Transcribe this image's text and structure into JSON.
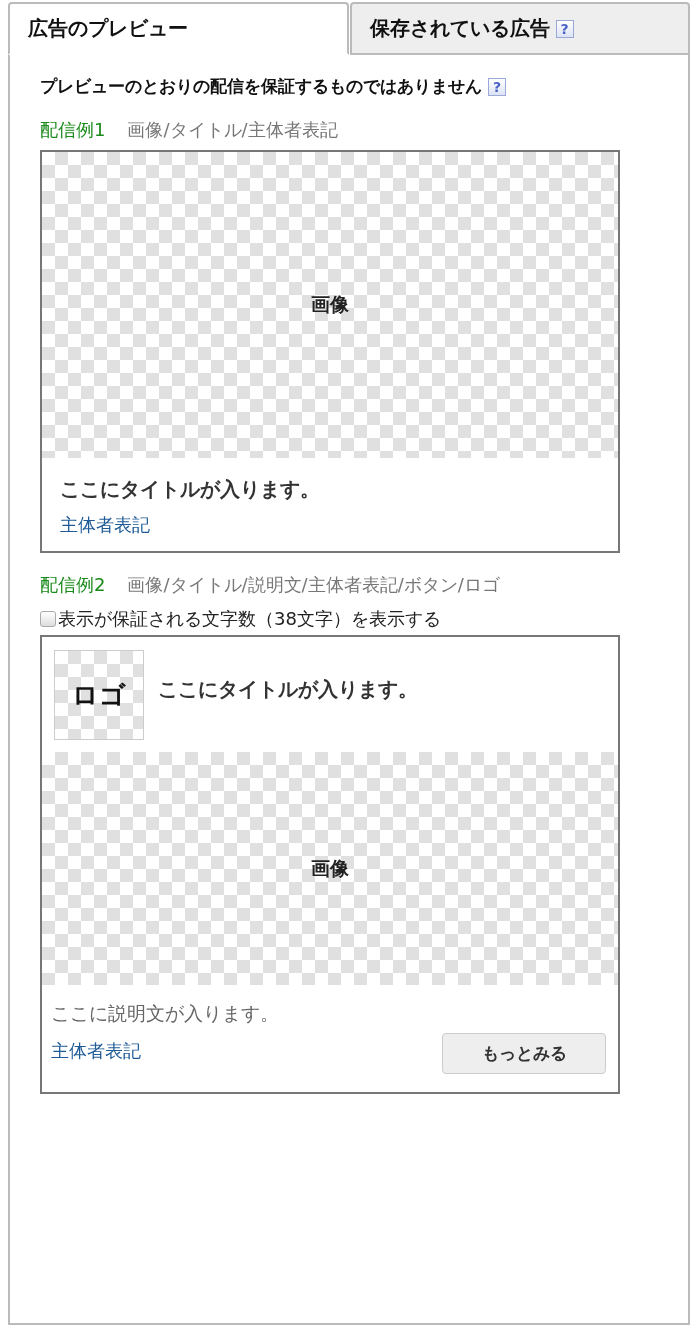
{
  "tabs": [
    {
      "label": "広告のプレビュー",
      "selected": true
    },
    {
      "label": "保存されている広告",
      "selected": false,
      "help": "?"
    }
  ],
  "notice": {
    "text": "プレビューのとおりの配信を保証するものではありません",
    "help": "?"
  },
  "examples": [
    {
      "kind": "image-top",
      "number": "配信例1",
      "elements": "画像/タイトル/主体者表記",
      "image_label": "画像",
      "title": "ここにタイトルが入ります。",
      "attribution": "主体者表記"
    },
    {
      "kind": "logo-top",
      "number": "配信例2",
      "elements": "画像/タイトル/説明文/主体者表記/ボタン/ロゴ",
      "checkbox": {
        "label": "表示が保証される文字数（38文字）を表示する",
        "checked": false
      },
      "logo_label": "ロゴ",
      "title": "ここにタイトルが入ります。",
      "image_label": "画像",
      "description": "ここに説明文が入ります。",
      "attribution": "主体者表記",
      "button": "もっとみる"
    }
  ]
}
